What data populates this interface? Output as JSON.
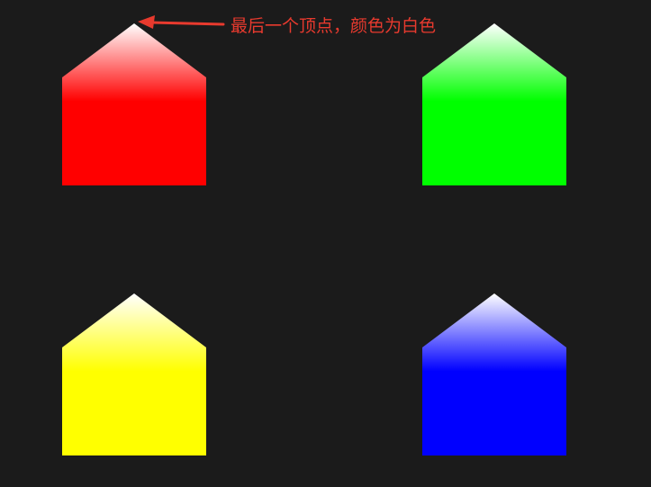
{
  "annotation": {
    "text": "最后一个顶点，颜色为白色",
    "color": "#e83a2e"
  },
  "canvas": {
    "background": "#1b1b1b"
  },
  "shapes": [
    {
      "name": "red-house-shape",
      "base_color": "#ff0000",
      "apex_color": "#ffffff"
    },
    {
      "name": "green-house-shape",
      "base_color": "#00ff00",
      "apex_color": "#ffffff"
    },
    {
      "name": "yellow-house-shape",
      "base_color": "#ffff00",
      "apex_color": "#ffffff"
    },
    {
      "name": "blue-house-shape",
      "base_color": "#0000ff",
      "apex_color": "#ffffff"
    }
  ]
}
